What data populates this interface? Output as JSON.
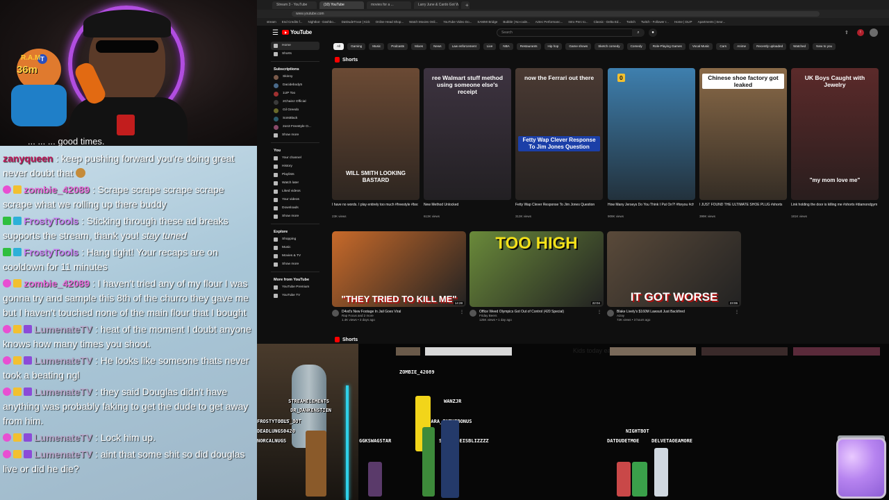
{
  "webcam": {
    "mascot_label": "R.A.M",
    "mascot_count": "36m",
    "mascot_badge": "T"
  },
  "chat": {
    "cut_line": "... ... ... good times.",
    "messages": [
      {
        "badges": [],
        "user": "zanyqueen",
        "user_color": "#c2185b",
        "text": "keep pushing forward you're doing great",
        "tail": "never doubt that"
      },
      {
        "badges": [
          "pink",
          "crown"
        ],
        "user": "zombie_42089",
        "user_color": "#e86bd9",
        "text": "Scrape scrape scrape scrape scrape what we rolling up there buddy"
      },
      {
        "badges": [
          "green",
          "ig"
        ],
        "user": "FrostyTools",
        "user_color": "#c77df0",
        "text": "Sticking through these ad breaks supports the stream, thank you!",
        "italic": "stay tuned"
      },
      {
        "badges": [
          "green",
          "ig"
        ],
        "user": "FrostyTools",
        "user_color": "#c77df0",
        "text": "Hang tight! Your recaps are on cooldown for 11 minutes"
      },
      {
        "badges": [
          "pink",
          "crown"
        ],
        "user": "zombie_42089",
        "user_color": "#e86bd9",
        "text": "I haven't tried any of my flour I was gonna try and sample this 8th of the churro they gave me but I haven't touched none of the main flour that I bought"
      },
      {
        "badges": [
          "pink",
          "crown",
          "purple"
        ],
        "user": "LumenateTV",
        "user_color": "#b9a6c9",
        "text": "heat of the moment I doubt anyone knows how many times you shoot."
      },
      {
        "badges": [
          "pink",
          "crown",
          "purple"
        ],
        "user": "LumenateTV",
        "user_color": "#b9a6c9",
        "text": "He looks like someone thats never took a beating ngl"
      },
      {
        "badges": [
          "pink",
          "crown",
          "purple"
        ],
        "user": "LumenateTV",
        "user_color": "#b9a6c9",
        "text": "they said Douglas didn't have anything was probably faking to get the dude to get away from him."
      },
      {
        "badges": [
          "pink",
          "crown",
          "purple"
        ],
        "user": "LumenateTV",
        "user_color": "#b9a6c9",
        "text": "Lock him up."
      },
      {
        "badges": [
          "pink",
          "crown",
          "purple"
        ],
        "user": "LumenateTV",
        "user_color": "#b9a6c9",
        "text": "aint that some shit so did douglas live or did he die?"
      }
    ]
  },
  "browser": {
    "tabs": [
      "Stream 3 - YouTube",
      "(10) YouTube",
      "movies for a ...",
      "Larry June & Cardo Got W...",
      "+"
    ],
    "active_tab": 1,
    "address": "www.youtube.com",
    "bookmarks": [
      "stream",
      "End Credits f...",
      "Nightbot - Dashbo...",
      "DatDudeTrxxe | Kick",
      "Online Head Shop...",
      "Watch Movies Onli...",
      "YouTube Video Do...",
      "SAMMI Bridge",
      "Bubble | No-code...",
      "Aztec Performanc...",
      "Intro Perc to...",
      "Classic - Delta Ed...",
      "Twitch",
      "Twitch - Follower r...",
      "Home | DLIP",
      "Apartments | Seor..."
    ]
  },
  "youtube": {
    "logo": "YouTube",
    "search_placeholder": "Search",
    "sidebar": {
      "main": [
        "Home",
        "Shorts"
      ],
      "subscriptions_head": "Subscriptions",
      "subscriptions": [
        "Skinny",
        "Dacidebody5",
        "1UP Too",
        "2Chainz Official",
        "Gil Greedo",
        "SoIsBlack",
        "2on3 Freestyle O...",
        "Show more"
      ],
      "you_head": "You",
      "you": [
        "Your channel",
        "History",
        "Playlists",
        "Watch later",
        "Liked videos",
        "Your videos",
        "Downloads",
        "Show more"
      ],
      "explore_head": "Explore",
      "explore": [
        "Shopping",
        "Music",
        "Movies & TV",
        "Show more"
      ],
      "more_head": "More from YouTube",
      "more": [
        "YouTube Premium",
        "YouTube TV"
      ]
    },
    "chips": [
      "All",
      "Gaming",
      "Music",
      "Podcasts",
      "Mixes",
      "News",
      "Law enforcement",
      "Live",
      "NBA",
      "Restaurants",
      "Hip hop",
      "Game shows",
      "Sketch comedy",
      "Comedy",
      "Role-Playing Games",
      "Vocal Music",
      "Cars",
      "Anime",
      "Recently uploaded",
      "Watched",
      "New to you"
    ],
    "shorts_label": "Shorts",
    "shorts": [
      {
        "cap_bottom": "WILL SMITH LOOKING BASTARD",
        "title": "I have no words. I play entirely too much #freestyle #bootlegkev",
        "views": "23K views",
        "bg": "#6b4a34",
        "cap_color": "#ffffff"
      },
      {
        "cap_top": "ree Walmart stuff method using someone else's receipt",
        "title": "New Method Unlocked",
        "views": "613K views",
        "bg": "#3d3340",
        "cap_color": "#ffffff"
      },
      {
        "cap_top": "now the Ferrari out there",
        "cap_bottom": "Fetty Wap Clever Response To Jim Jones Question",
        "title": "Fetty Wap Clever Response To Jim Jones Question",
        "views": "313K views",
        "bg": "#4a3a33",
        "cap_color": "#ffffff"
      },
      {
        "cap_top": "0",
        "title": "How Many Jerseys Do You Think I Put On?! #foryou #challenge #basketball",
        "views": "909K views",
        "bg": "#3e7fae",
        "cap_color": "#ffffff"
      },
      {
        "cap_top": "Chinese shoe factory got leaked",
        "title": "I JUST FOUND THE ULTIMATE SHOE PLUG #shorts",
        "views": "399K views",
        "bg": "#8a6a48",
        "cap_color": "#111111"
      },
      {
        "cap_top": "UK Boys Caught with Jewelry",
        "cap_bottom": "\"my mom love me\"",
        "title": "Link holding the door is killing me #shorts #diamondgym",
        "views": "181K views",
        "bg": "#5b2a2a",
        "cap_color": "#ffffff"
      }
    ],
    "videos": [
      {
        "big": "\"THEY TRIED TO KILL ME\"",
        "duration": "14:28",
        "title": "D4vd's New Footage In Jail Goes Viral",
        "channel": "Rap Focus and 2 more",
        "stats": "1.4K views • 3 days ago",
        "bg": "#c86a2a"
      },
      {
        "big": "TOO HIGH",
        "duration": "22:04",
        "title": "Office Weed Olympics Got Out of Control (420 Special)",
        "channel": "Friday Beers",
        "stats": "125K views • 1 day ago",
        "bg": "#6a8a3a"
      },
      {
        "big": "IT GOT WORSE",
        "duration": "23:06",
        "title": "Blake Lively's $160M Lawsuit Just Backfired",
        "channel": "Aizay",
        "stats": "72K views • 3 hours ago",
        "bg": "#5a4a3a"
      }
    ],
    "shorts2_label": "Shorts"
  },
  "scene": {
    "preview_text": "Kids today eating a",
    "names": [
      "ZOMBIE_42089",
      "WANZJR",
      "CIARA_INTHEBONUS",
      "SOLITUDEISBLIZZZZ",
      "GGKSWAGSTAR",
      "STREAMELEMENTS",
      "DR_DANKENSTIEN",
      "SEXY_BOT",
      "FROSTYTOOLS",
      "DEADLUNGS0420",
      "NORCALNUGS",
      "NIGHTBOT",
      "DATDUDETMOE",
      "DELVETAOEAMORE"
    ]
  },
  "colors": {
    "yt_red": "#ff0000",
    "chat_bg": "#b4cfdf",
    "webcam_ring": "#b14de0"
  }
}
